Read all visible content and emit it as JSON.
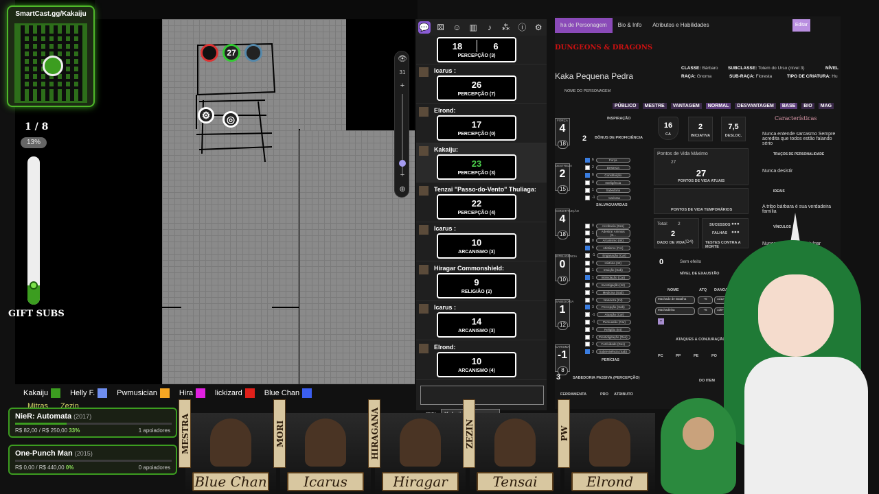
{
  "overlay": {
    "qr_label": "SmartCast.gg/Kakaiju",
    "sub_count": "1 / 8",
    "sub_percent": "13%",
    "sub_fraction": 0.13,
    "gift_label": "GIFT SUBS",
    "players": [
      {
        "name": "Kakaiju",
        "color": "#3c9d20"
      },
      {
        "name": "Helly F.",
        "color": "#6f8ef0"
      },
      {
        "name": "Pwmusician",
        "color": "#f5a623"
      },
      {
        "name": "Hira",
        "color": "#e020e0"
      },
      {
        "name": "lickizard",
        "color": "#e0201a"
      },
      {
        "name": "Blue Chan",
        "color": "#3b5ef0"
      }
    ],
    "players2": [
      "Mitras",
      "Zezin"
    ],
    "goals": [
      {
        "title": "NieR: Automata",
        "year": "(2017)",
        "amount": "R$ 82,00 / R$ 250,00",
        "percent": "33%",
        "fraction": 0.33,
        "backers": "1 apoiadores"
      },
      {
        "title": "One-Punch Man",
        "year": "(2015)",
        "amount": "R$ 0,00 / R$ 440,00",
        "percent": "0%",
        "fraction": 0,
        "backers": "0 apoiadores"
      }
    ]
  },
  "map": {
    "token_value": "27",
    "zoom_level": "31"
  },
  "toolbar": {
    "icons": [
      "chat-icon",
      "dice-icon",
      "user-group-icon",
      "library-icon",
      "audio-icon",
      "nodes-icon",
      "info-icon",
      "gear-icon"
    ]
  },
  "rolls": [
    {
      "name": "",
      "value": "18",
      "value2": "6",
      "label": "PERCEPÇÃO (3)",
      "split": true
    },
    {
      "name": "Icarus :",
      "value": "26",
      "label": "PERCEPÇÃO (7)"
    },
    {
      "name": "Elrond:",
      "value": "17",
      "label": "PERCEPÇÃO (0)"
    },
    {
      "name": "Kakaiju:",
      "value": "23",
      "label": "PERCEPÇÃO (3)",
      "highlight": true,
      "green": true
    },
    {
      "name": "Tenzai \"Passo-do-Vento\" Thuliaga:",
      "value": "22",
      "label": "PERCEPÇÃO (4)"
    },
    {
      "name": "Icarus :",
      "value": "10",
      "label": "ARCANISMO (3)"
    },
    {
      "name": "Hiragar Commonshield:",
      "value": "9",
      "label": "RELIGIÃO (2)"
    },
    {
      "name": "Icarus :",
      "value": "14",
      "label": "ARCANISMO (3)"
    },
    {
      "name": "Elrond:",
      "value": "10",
      "label": "ARCANISMO (4)"
    }
  ],
  "chat": {
    "as_label": "mo:",
    "as_value": "Kakaiju"
  },
  "sheet": {
    "tabs": [
      "ha de Personagem",
      "Bio & Info",
      "Atributos e Habilidades"
    ],
    "edit": "Editar",
    "logo": "DUNGEONS & DRAGONS",
    "char_name": "Kaka Pequena Pedra",
    "char_name_label": "NOME DO PERSONAGEM",
    "class_label": "CLASSE:",
    "class_value": "Bárbaro",
    "subclass_label": "SUBCLASSE:",
    "subclass_value": "Totem do Urso (nível 3)",
    "level_label": "NÍVEL",
    "race_label": "RAÇA:",
    "race_value": "Gnoma",
    "subrace_label": "SUB-RAÇA:",
    "subrace_value": "Floresta",
    "creature_label": "TIPO DE CRIATURA:",
    "creature_value": "Hu",
    "modes": [
      "PÚBLICO",
      "MESTRE",
      "VANTAGEM",
      "NORMAL",
      "DESVANTAGEM",
      "BASE",
      "BIO",
      "MAG"
    ],
    "inspiration": "INSPIRAÇÃO",
    "proficiency_value": "2",
    "proficiency_label": "BÔNUS DE PROFICIÊNCIA",
    "abilities": [
      {
        "name": "FORÇA",
        "score": "4",
        "mod": "18"
      },
      {
        "name": "DESTREZA",
        "score": "2",
        "mod": "15"
      },
      {
        "name": "CONSTITUIÇÃO",
        "score": "4",
        "mod": "18"
      },
      {
        "name": "INTELIGÊNCIA",
        "score": "0",
        "mod": "10"
      },
      {
        "name": "SABEDORIA",
        "score": "1",
        "mod": "12"
      },
      {
        "name": "CARISMA",
        "score": "-1",
        "mod": "8"
      }
    ],
    "saves": [
      {
        "v": "6",
        "label": "Força",
        "on": true
      },
      {
        "v": "2",
        "label": "Destreza",
        "on": false
      },
      {
        "v": "6",
        "label": "Constituição",
        "on": true
      },
      {
        "v": "0",
        "label": "Inteligência",
        "on": false
      },
      {
        "v": "1",
        "label": "Sabedoria",
        "on": false
      },
      {
        "v": "-1",
        "label": "Carisma",
        "on": false
      }
    ],
    "saves_label": "SALVAGUARDAS",
    "ac": "16",
    "ac_label": "CA",
    "initiative": "2",
    "initiative_label": "INICIATIVA",
    "speed": "7,5",
    "speed_label": "DESLOC.",
    "hp_max_label": "Pontos de Vida Máximo",
    "hp_max": "27",
    "hp_current": "27",
    "hp_current_label": "PONTOS DE VIDA ATUAIS",
    "hp_temp_label": "PONTOS DE VIDA TEMPORÁRIOS",
    "hit_dice_total_label": "Total:",
    "hit_dice_total": "2",
    "hit_dice": "2",
    "hit_dice_type": "(D4)",
    "hit_dice_label": "DADO DE VIDA",
    "death_success": "SUCESSOS",
    "death_fail": "FALHAS",
    "death_label": "TESTES CONTRA A MORTE",
    "exhaustion": "0",
    "exhaustion_label": "NÍVEL DE EXAUSTÃO",
    "exhaustion_effect": "Sem efeito",
    "skills": [
      {
        "v": "0",
        "label": "Acrobacia (Des)",
        "on": false
      },
      {
        "v": "1",
        "label": "Adestrar Animais (S...",
        "on": false
      },
      {
        "v": "0",
        "label": "Arcanismo (Int)",
        "on": false
      },
      {
        "v": "6",
        "label": "Atletismo (For)",
        "on": true
      },
      {
        "v": "-1",
        "label": "Enganação (Car)",
        "on": false
      },
      {
        "v": "0",
        "label": "História (Int)",
        "on": false
      },
      {
        "v": "1",
        "label": "Intuição (Sab)",
        "on": false
      },
      {
        "v": "1",
        "label": "Intimidação (Car)",
        "on": true
      },
      {
        "v": "0",
        "label": "Investigação (Int)",
        "on": false
      },
      {
        "v": "1",
        "label": "Medicina (Sab)",
        "on": false
      },
      {
        "v": "0",
        "label": "Natureza (Int)",
        "on": false
      },
      {
        "v": "3",
        "label": "Percepção (Sab)",
        "on": true
      },
      {
        "v": "-1",
        "label": "Atuação (Car)",
        "on": false
      },
      {
        "v": "-1",
        "label": "Persuasão (Car)",
        "on": false
      },
      {
        "v": "0",
        "label": "Religião (Int)",
        "on": false
      },
      {
        "v": "2",
        "label": "Prestidigitação (Des)",
        "on": false
      },
      {
        "v": "2",
        "label": "Furtividade (Des)",
        "on": false
      },
      {
        "v": "3",
        "label": "Sobrevivência (Sab)",
        "on": true
      }
    ],
    "skills_label": "PERÍCIAS",
    "passive_value": "3",
    "passive_label": "SABEDORIA PASSIVA (PERCEPÇÃO)",
    "attacks_header": [
      "NOME",
      "ATQ",
      "DANO/TIPO"
    ],
    "attacks": [
      {
        "name": "Machado de Batalha",
        "atk": "+6",
        "dmg": "1d12+4"
      },
      {
        "name": "Machadinha",
        "atk": "+6",
        "dmg": "1d6+4"
      }
    ],
    "attacks_label": "ATAQUES & CONJURAÇÃO",
    "coins": [
      "PC",
      "PP",
      "PE",
      "PO"
    ],
    "item_label": "DO ITEM",
    "equipment_label": "FERRAMENTA",
    "prof_label": "PRO",
    "attr_label": "ATRIBUTO",
    "char_title": "Características",
    "traits": [
      {
        "text": "Nunca entende sarcasmo Sempre acredita que todos estão falando sério",
        "title": "TRAÇOS DE PERSONALIDADE"
      },
      {
        "text": "Nunca desistir",
        "title": "IDEAIS"
      },
      {
        "text": "A tribo bárbara é sua verdadeira família",
        "title": "VÍNCULOS"
      },
      {
        "text": "Nunca... sarcasmo ... julgar",
        "title": ""
      }
    ]
  },
  "portraits": {
    "names": [
      "Blue Chan",
      "Icarus",
      "Hiragar",
      "Tensai",
      "Elrond"
    ],
    "tags": [
      "MESTRA",
      "MORI",
      "HIRAGANA",
      "ZEZIN",
      "PW"
    ]
  }
}
